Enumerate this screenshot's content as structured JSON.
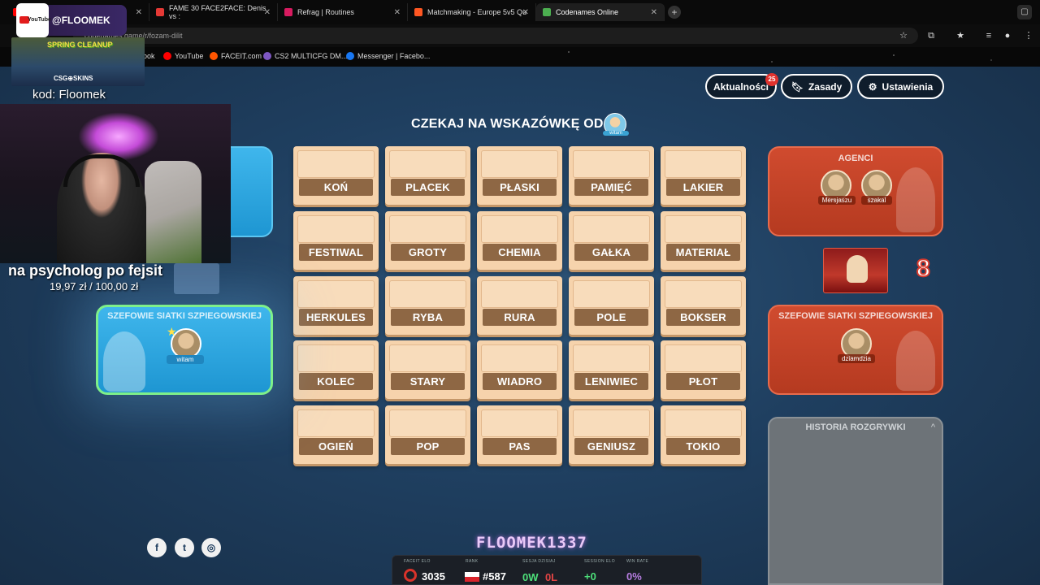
{
  "browser": {
    "tabs": [
      {
        "title": "",
        "color": "#ff0000"
      },
      {
        "title": "FAME 30 FACE2FACE: Denis vs :",
        "color": "#e53935"
      },
      {
        "title": "Refrag | Routines",
        "color": "#d81b60"
      },
      {
        "title": "Matchmaking - Europe 5v5 Qu",
        "color": "#ff5722"
      },
      {
        "title": "Codenames Online",
        "color": "#4caf50"
      }
    ],
    "url": "codenames.game/r/fozam-dilit",
    "bookmarks": [
      {
        "label": "ook",
        "color": "#1877f2"
      },
      {
        "label": "YouTube",
        "color": "#ff0000"
      },
      {
        "label": "FACEIT.com",
        "color": "#ff5500"
      },
      {
        "label": "CS2 MULTICFG DM...",
        "color": "#7e57c2"
      },
      {
        "label": "Messenger | Facebo...",
        "color": "#1877f2"
      }
    ]
  },
  "header": {
    "news_label": "Aktualności",
    "news_badge": "25",
    "rules_label": "Zasady",
    "settings_label": "Ustawienia"
  },
  "status": {
    "message": "CZEKAJ NA WSKAZÓWKĘ OD",
    "avatar_name": "witam"
  },
  "board": [
    [
      "KOŃ",
      "PLACEK",
      "PŁASKI",
      "PAMIĘĆ",
      "LAKIER"
    ],
    [
      "FESTIWAL",
      "GROTY",
      "CHEMIA",
      "GAŁKA",
      "MATERIAŁ"
    ],
    [
      "HERKULES",
      "RYBA",
      "RURA",
      "POLE",
      "BOKSER"
    ],
    [
      "KOLEC",
      "STARY",
      "WIADRO",
      "LENIWIEC",
      "PŁOT"
    ],
    [
      "OGIEŃ",
      "POP",
      "PAS",
      "GENIUSZ",
      "TOKIO"
    ]
  ],
  "red_team": {
    "agents_title": "AGENCI",
    "agents": [
      "Mersjaszu",
      "szakal"
    ],
    "spymaster_title": "SZEFOWIE SIATKI SZPIEGOWSKIEJ",
    "spymasters": [
      "dziamdzia"
    ],
    "cards_left": "8"
  },
  "blue_team": {
    "spymaster_title": "SZEFOWIE SIATKI SZPIEGOWSKIEJ",
    "spymasters": [
      "witam"
    ]
  },
  "history": {
    "title": "HISTORIA ROZGRYWKI"
  },
  "social": [
    "f",
    "t",
    "◎"
  ],
  "profile": {
    "username": "FLOOMEK1337",
    "faceit_elo_label": "FACEIT ELO",
    "faceit_elo": "3035",
    "rank_label": "RANK",
    "rank": "#587",
    "session_label": "SESJA DZISIAJ",
    "session_w": "0W",
    "session_l": "0L",
    "session_elo_label": "SESSION ELO",
    "session_elo": "+0",
    "winrate_label": "WIN RATE",
    "winrate": "0%"
  },
  "overlay": {
    "yt_text": "YouTube",
    "handle": "@FLOOMEK",
    "ad_title": "SPRING CLEANUP",
    "ad_brand": "CSG⊕SKINS",
    "code": "kod: Floomek",
    "donation_text": "na psycholog po fejsit",
    "donation_amount": "19,97 zł / 100,00 zł"
  }
}
